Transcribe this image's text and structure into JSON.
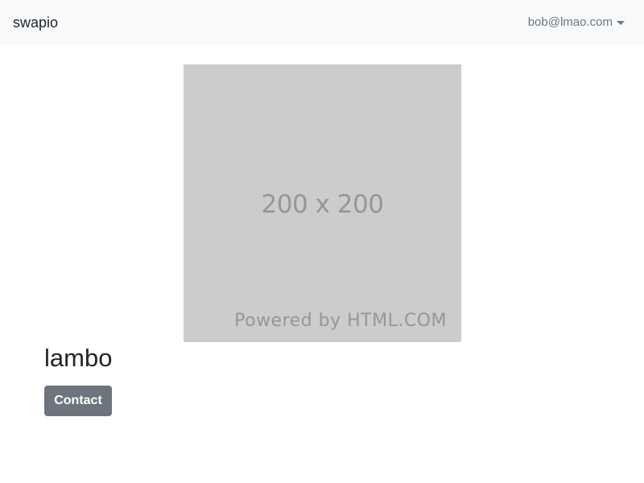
{
  "navbar": {
    "brand": "swapio",
    "user_email": "bob@lmao.com",
    "dropdown_icon": "caret-down-icon"
  },
  "image": {
    "size_label": "200 x 200",
    "powered_label": "Powered by HTML.COM"
  },
  "item": {
    "title": "lambo",
    "contact_label": "Contact"
  },
  "colors": {
    "navbar_bg": "#f8f9fa",
    "placeholder_bg": "#cccccc",
    "button_bg": "#6c757d",
    "text": "#212529",
    "muted": "#6c757d"
  }
}
